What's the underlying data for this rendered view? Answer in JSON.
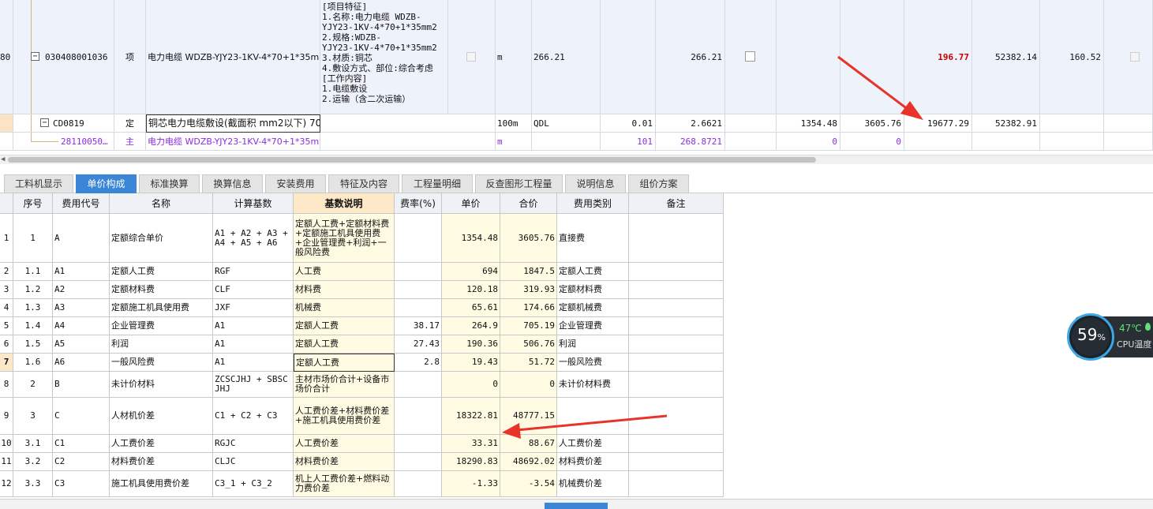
{
  "top_rows": {
    "row1": {
      "seq": "80",
      "code": "030408001036",
      "kind": "项",
      "name": "电力电缆 WDZB-YJY23-1KV-4*70+1*35mm2",
      "features": [
        "[项目特征]",
        "1.名称:电力电缆 WDZB-",
        "YJY23-1KV-4*70+1*35mm2",
        "2.规格:WDZB-",
        "YJY23-1KV-4*70+1*35mm2",
        "3.材质:铜芯",
        "4.敷设方式、部位:综合考虑",
        "[工作内容]",
        "1.电缆敷设",
        "2.运输（含二次运输）"
      ],
      "unit": "m",
      "expr": "266.21",
      "qty": "266.21",
      "unit_price": "196.77",
      "total": "52382.14",
      "col_extra": "160.52"
    },
    "row2": {
      "code": "CD0819",
      "kind": "定",
      "name": "铜芯电力电缆敷设(截面积 mm2以下) 70",
      "unit": "100m",
      "expr": "QDL",
      "ratio": "0.01",
      "qty": "2.6621",
      "price": "1354.48",
      "sum": "3605.76",
      "unit_price": "19677.29",
      "total": "52382.91"
    },
    "row3": {
      "code": "28110050…",
      "kind": "主",
      "name": "电力电缆 WDZB-YJY23-1KV-4*70+1*35mm2",
      "unit": "m",
      "ratio": "101",
      "qty": "268.8721",
      "price": "0",
      "sum": "0"
    }
  },
  "tabs": [
    "工料机显示",
    "单价构成",
    "标准换算",
    "换算信息",
    "安装费用",
    "特征及内容",
    "工程量明细",
    "反查图形工程量",
    "说明信息",
    "组价方案"
  ],
  "active_tab": "单价构成",
  "grid": {
    "headers": [
      "序号",
      "费用代号",
      "名称",
      "计算基数",
      "基数说明",
      "费率(%)",
      "单价",
      "合价",
      "费用类别",
      "备注"
    ],
    "rows": [
      {
        "n": "1",
        "seq": "1",
        "code": "A",
        "name": "定额综合单价",
        "base": "A1 + A2 + A3 + A4 + A5 + A6",
        "desc": "定额人工费+定额材料费+定额施工机具使用费+企业管理费+利润+一般风险费",
        "rate": "",
        "price": "1354.48",
        "total": "3605.76",
        "cat": "直接费"
      },
      {
        "n": "2",
        "seq": "1.1",
        "code": "A1",
        "name": "定额人工费",
        "base": "RGF",
        "desc": "人工费",
        "rate": "",
        "price": "694",
        "total": "1847.5",
        "cat": "定额人工费"
      },
      {
        "n": "3",
        "seq": "1.2",
        "code": "A2",
        "name": "定额材料费",
        "base": "CLF",
        "desc": "材料费",
        "rate": "",
        "price": "120.18",
        "total": "319.93",
        "cat": "定额材料费"
      },
      {
        "n": "4",
        "seq": "1.3",
        "code": "A3",
        "name": "定额施工机具使用费",
        "base": "JXF",
        "desc": "机械费",
        "rate": "",
        "price": "65.61",
        "total": "174.66",
        "cat": "定额机械费"
      },
      {
        "n": "5",
        "seq": "1.4",
        "code": "A4",
        "name": "企业管理费",
        "base": "A1",
        "desc": "定额人工费",
        "rate": "38.17",
        "price": "264.9",
        "total": "705.19",
        "cat": "企业管理费"
      },
      {
        "n": "6",
        "seq": "1.5",
        "code": "A5",
        "name": "利润",
        "base": "A1",
        "desc": "定额人工费",
        "rate": "27.43",
        "price": "190.36",
        "total": "506.76",
        "cat": "利润"
      },
      {
        "n": "7",
        "seq": "1.6",
        "code": "A6",
        "name": "一般风险费",
        "base": "A1",
        "desc": "定额人工费",
        "rate": "2.8",
        "price": "19.43",
        "total": "51.72",
        "cat": "一般风险费"
      },
      {
        "n": "8",
        "seq": "2",
        "code": "B",
        "name": "未计价材料",
        "base": "ZCSCJHJ + SBSCJHJ",
        "desc": "主材市场价合计+设备市场价合计",
        "rate": "",
        "price": "0",
        "total": "0",
        "cat": "未计价材料费"
      },
      {
        "n": "9",
        "seq": "3",
        "code": "C",
        "name": "人材机价差",
        "base": "C1 + C2 + C3",
        "desc": "人工费价差+材料费价差+施工机具使用费价差",
        "rate": "",
        "price": "18322.81",
        "total": "48777.15",
        "cat": ""
      },
      {
        "n": "10",
        "seq": "3.1",
        "code": "C1",
        "name": "人工费价差",
        "base": "RGJC",
        "desc": "人工费价差",
        "rate": "",
        "price": "33.31",
        "total": "88.67",
        "cat": "人工费价差"
      },
      {
        "n": "11",
        "seq": "3.2",
        "code": "C2",
        "name": "材料费价差",
        "base": "CLJC",
        "desc": "材料费价差",
        "rate": "",
        "price": "18290.83",
        "total": "48692.02",
        "cat": "材料费价差"
      },
      {
        "n": "12",
        "seq": "3.3",
        "code": "C3",
        "name": "施工机具使用费价差",
        "base": "C3_1 + C3_2",
        "desc": "机上人工费价差+燃料动力费价差",
        "rate": "",
        "price": "-1.33",
        "total": "-3.54",
        "cat": "机械费价差"
      }
    ]
  },
  "cpu": {
    "percent": "59",
    "percent_unit": "%",
    "temp": "47℃",
    "label": "CPU温度"
  },
  "colors": {
    "accent": "#3b86d6",
    "red": "#cc0000",
    "purple": "#8a2be2",
    "arrow": "#e8332a"
  }
}
